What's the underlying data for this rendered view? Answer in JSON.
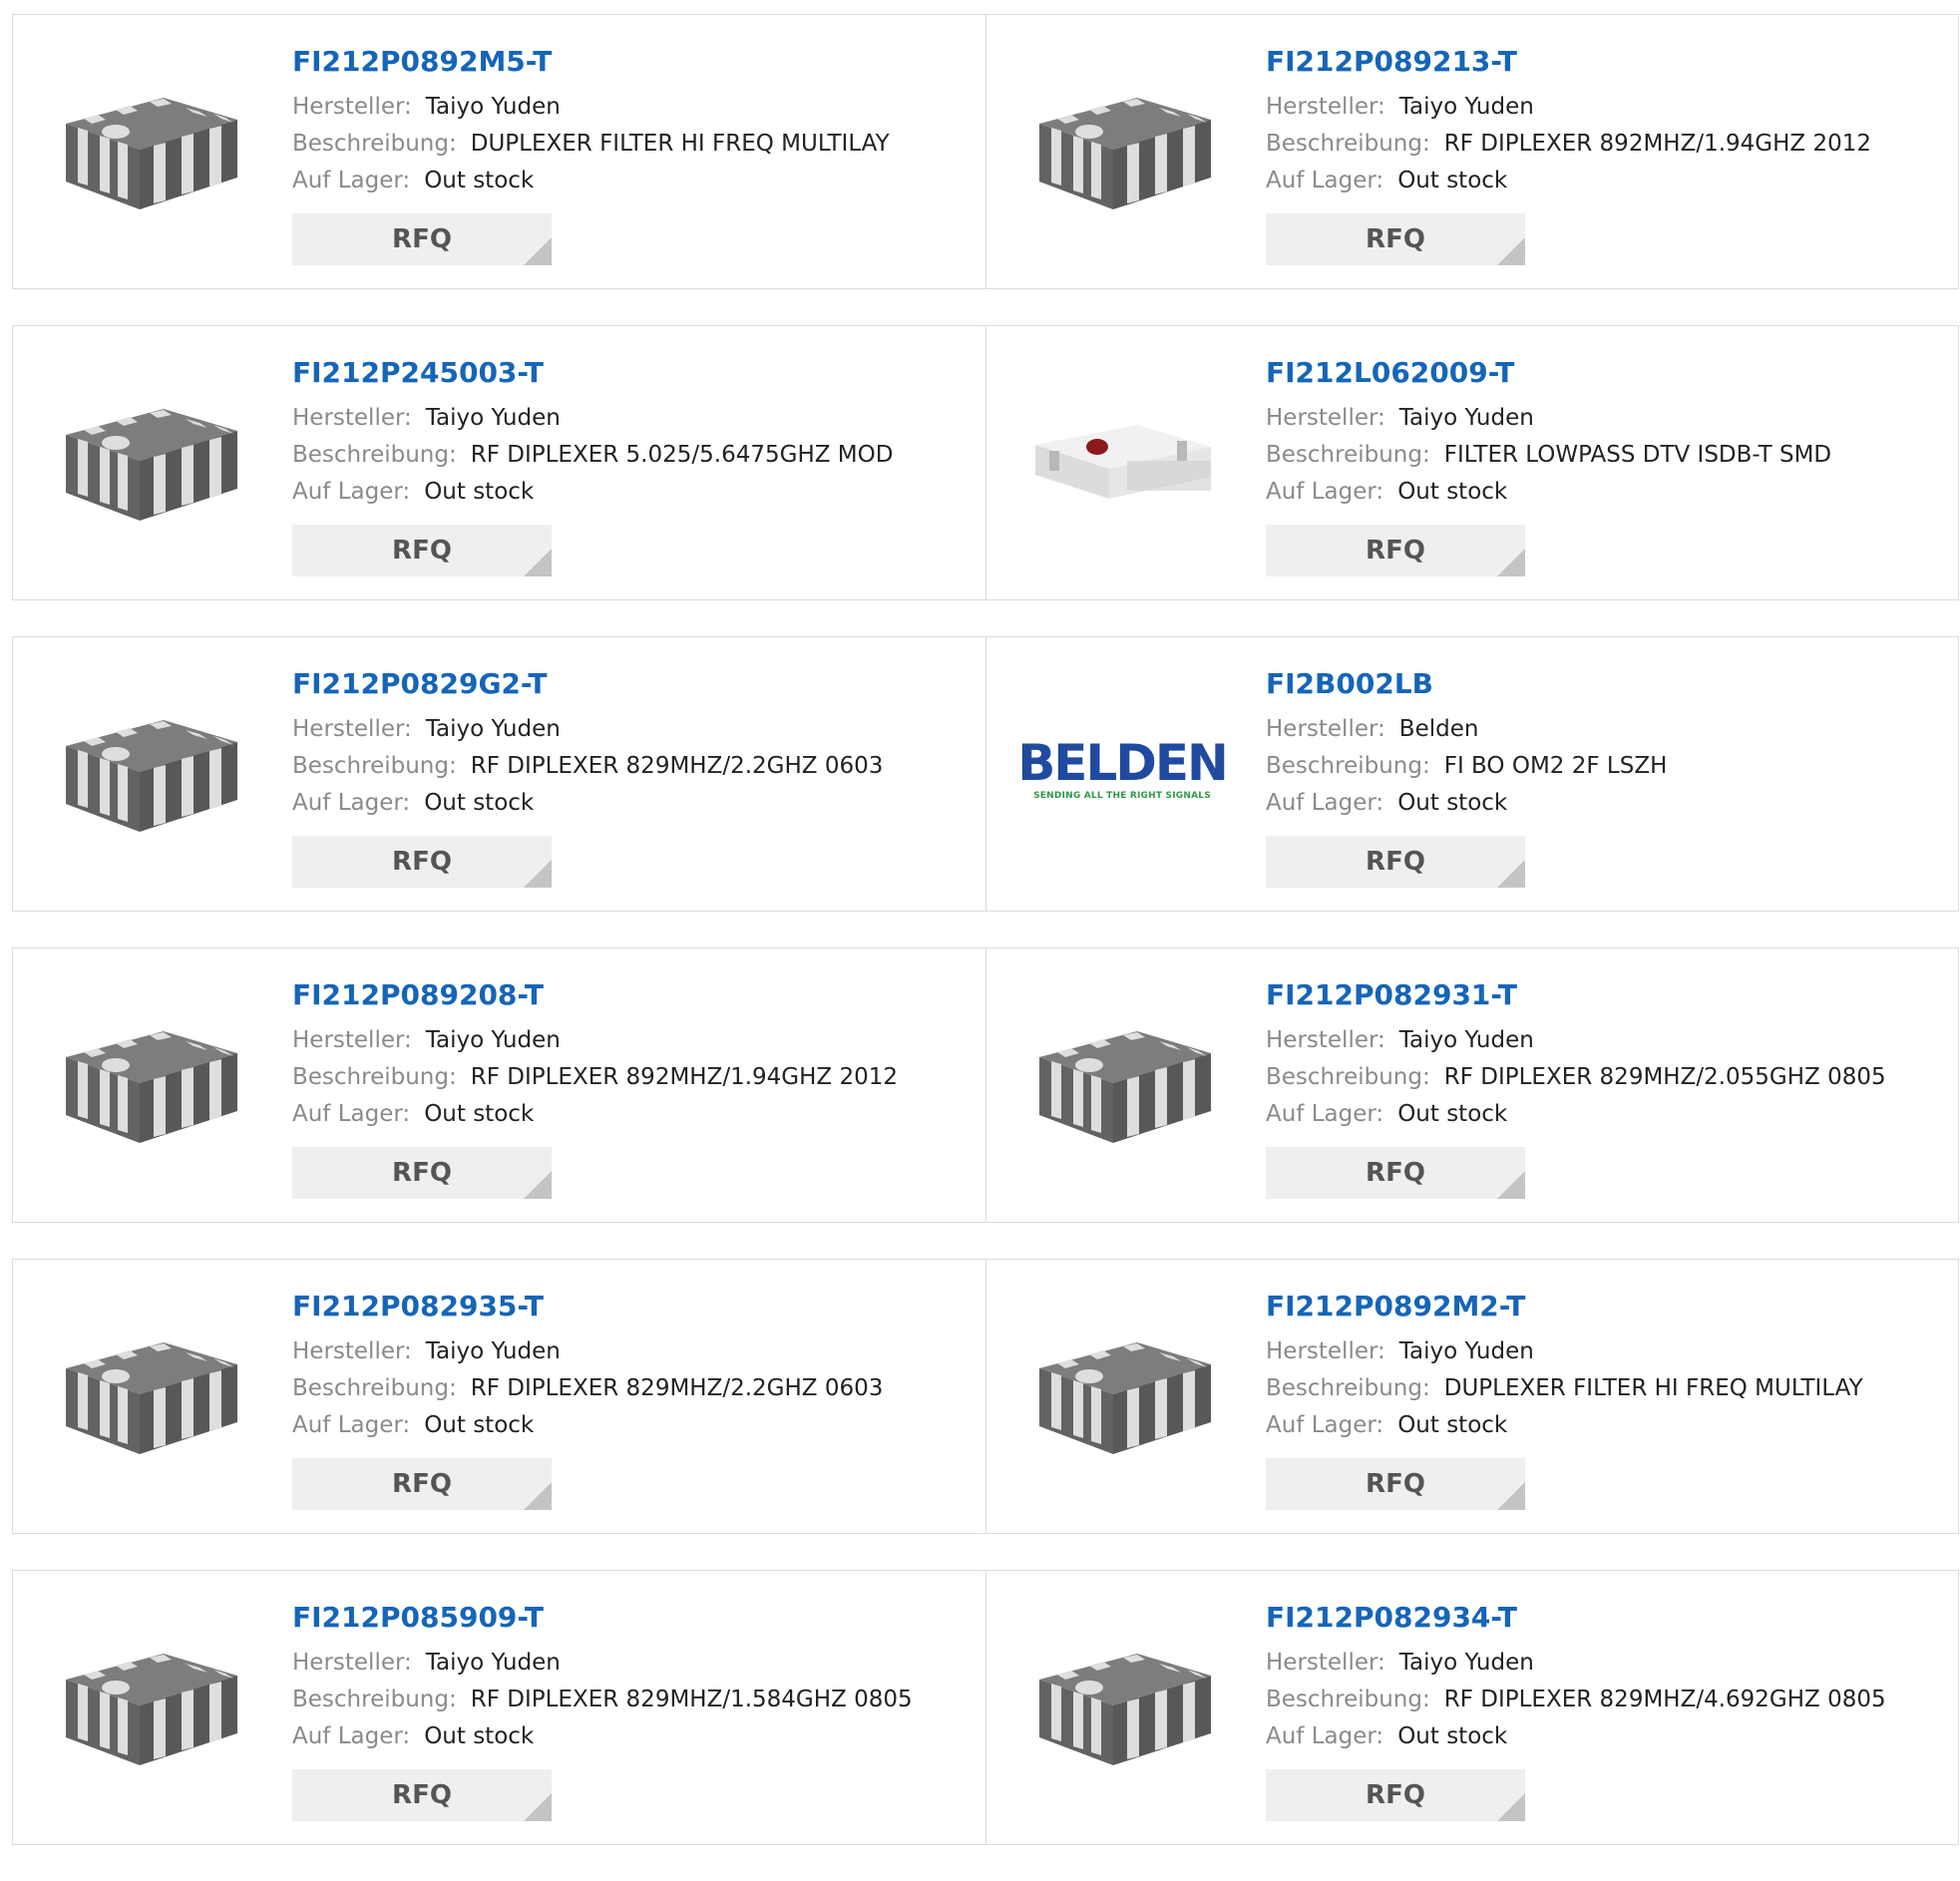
{
  "labels": {
    "manufacturer": "Hersteller:",
    "description": "Beschreibung:",
    "stock": "Auf Lager:",
    "rfq": "RFQ"
  },
  "colors": {
    "link": "#1565b8",
    "label": "#8a8a8a",
    "rfq_bg": "#efefef",
    "chip_dark": "#636363",
    "chip_light": "#dedede",
    "belden_blue": "#1f4aa0",
    "belden_green": "#2e9a47"
  },
  "products": [
    {
      "part": "FI212P0892M5-T",
      "manufacturer": "Taiyo Yuden",
      "description": "DUPLEXER FILTER HI FREQ MULTILAY",
      "stock": "Out stock",
      "image": "diplexer-chip-image"
    },
    {
      "part": "FI212P089213-T",
      "manufacturer": "Taiyo Yuden",
      "description": "RF DIPLEXER 892MHZ/1.94GHZ 2012",
      "stock": "Out stock",
      "image": "diplexer-chip-image"
    },
    {
      "part": "FI212P245003-T",
      "manufacturer": "Taiyo Yuden",
      "description": "RF DIPLEXER 5.025/5.6475GHZ MOD",
      "stock": "Out stock",
      "image": "diplexer-chip-image"
    },
    {
      "part": "FI212L062009-T",
      "manufacturer": "Taiyo Yuden",
      "description": "FILTER LOWPASS DTV ISDB-T SMD",
      "stock": "Out stock",
      "image": "lowpass-filter-image"
    },
    {
      "part": "FI212P0829G2-T",
      "manufacturer": "Taiyo Yuden",
      "description": "RF DIPLEXER 829MHZ/2.2GHZ 0603",
      "stock": "Out stock",
      "image": "diplexer-chip-image"
    },
    {
      "part": "FI2B002LB",
      "manufacturer": "Belden",
      "description": "FI BO OM2 2F LSZH",
      "stock": "Out stock",
      "image": "belden-logo",
      "logo_text": "BELDEN",
      "logo_tagline": "SENDING ALL THE RIGHT SIGNALS"
    },
    {
      "part": "FI212P089208-T",
      "manufacturer": "Taiyo Yuden",
      "description": "RF DIPLEXER 892MHZ/1.94GHZ 2012",
      "stock": "Out stock",
      "image": "diplexer-chip-image"
    },
    {
      "part": "FI212P082931-T",
      "manufacturer": "Taiyo Yuden",
      "description": "RF DIPLEXER 829MHZ/2.055GHZ 0805",
      "stock": "Out stock",
      "image": "diplexer-chip-image"
    },
    {
      "part": "FI212P082935-T",
      "manufacturer": "Taiyo Yuden",
      "description": "RF DIPLEXER 829MHZ/2.2GHZ 0603",
      "stock": "Out stock",
      "image": "diplexer-chip-image"
    },
    {
      "part": "FI212P0892M2-T",
      "manufacturer": "Taiyo Yuden",
      "description": "DUPLEXER FILTER HI FREQ MULTILAY",
      "stock": "Out stock",
      "image": "diplexer-chip-image"
    },
    {
      "part": "FI212P085909-T",
      "manufacturer": "Taiyo Yuden",
      "description": "RF DIPLEXER 829MHZ/1.584GHZ 0805",
      "stock": "Out stock",
      "image": "diplexer-chip-image"
    },
    {
      "part": "FI212P082934-T",
      "manufacturer": "Taiyo Yuden",
      "description": "RF DIPLEXER 829MHZ/4.692GHZ 0805",
      "stock": "Out stock",
      "image": "diplexer-chip-image"
    }
  ]
}
